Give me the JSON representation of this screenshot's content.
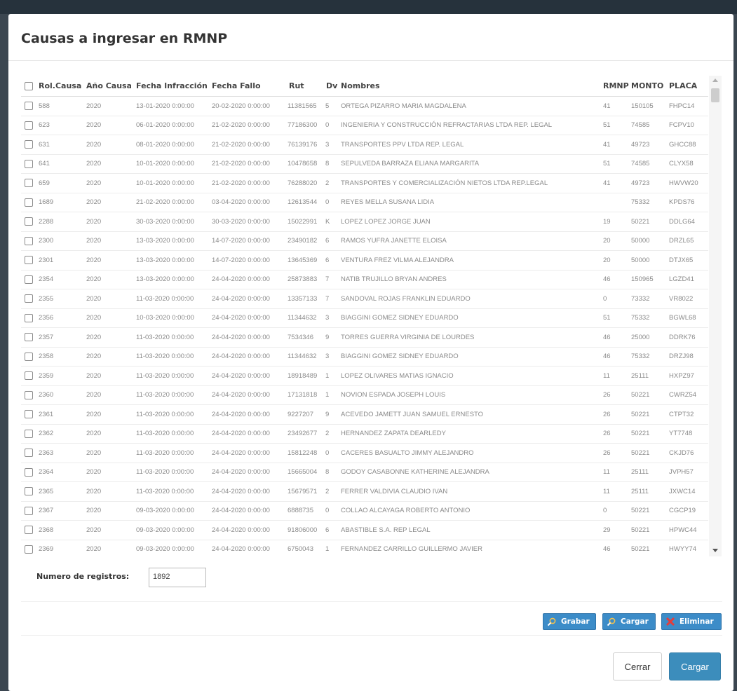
{
  "modal": {
    "title": "Causas a ingresar en RMNP"
  },
  "table": {
    "columns": [
      "Rol.Causa",
      "Año Causa",
      "Fecha Infracción",
      "Fecha Fallo",
      "Rut",
      "Dv",
      "Nombres",
      "RMNP",
      "MONTO",
      "PLACA"
    ],
    "rows": [
      [
        "588",
        "2020",
        "13-01-2020 0:00:00",
        "20-02-2020 0:00:00",
        "11381565",
        "5",
        "ORTEGA PIZARRO MARIA MAGDALENA",
        "41",
        "150105",
        "FHPC14"
      ],
      [
        "623",
        "2020",
        "06-01-2020 0:00:00",
        "21-02-2020 0:00:00",
        "77186300",
        "0",
        "INGENIERIA Y CONSTRUCCIÓN REFRACTARIAS LTDA REP. LEGAL",
        "51",
        "74585",
        "FCPV10"
      ],
      [
        "631",
        "2020",
        "08-01-2020 0:00:00",
        "21-02-2020 0:00:00",
        "76139176",
        "3",
        "TRANSPORTES PPV LTDA REP. LEGAL",
        "41",
        "49723",
        "GHCC88"
      ],
      [
        "641",
        "2020",
        "10-01-2020 0:00:00",
        "21-02-2020 0:00:00",
        "10478658",
        "8",
        "SEPULVEDA BARRAZA ELIANA MARGARITA",
        "51",
        "74585",
        "CLYX58"
      ],
      [
        "659",
        "2020",
        "10-01-2020 0:00:00",
        "21-02-2020 0:00:00",
        "76288020",
        "2",
        "TRANSPORTES Y COMERCIALIZACIÓN NIETOS LTDA REP.LEGAL",
        "41",
        "49723",
        "HWVW20"
      ],
      [
        "1689",
        "2020",
        "21-02-2020 0:00:00",
        "03-04-2020 0:00:00",
        "12613544",
        "0",
        "REYES MELLA SUSANA LIDIA",
        "",
        "75332",
        "KPDS76"
      ],
      [
        "2288",
        "2020",
        "30-03-2020 0:00:00",
        "30-03-2020 0:00:00",
        "15022991",
        "K",
        "LOPEZ LOPEZ JORGE JUAN",
        "19",
        "50221",
        "DDLG64"
      ],
      [
        "2300",
        "2020",
        "13-03-2020 0:00:00",
        "14-07-2020 0:00:00",
        "23490182",
        "6",
        "RAMOS YUFRA JANETTE ELOISA",
        "20",
        "50000",
        "DRZL65"
      ],
      [
        "2301",
        "2020",
        "13-03-2020 0:00:00",
        "14-07-2020 0:00:00",
        "13645369",
        "6",
        "VENTURA FREZ VILMA ALEJANDRA",
        "20",
        "50000",
        "DTJX65"
      ],
      [
        "2354",
        "2020",
        "13-03-2020 0:00:00",
        "24-04-2020 0:00:00",
        "25873883",
        "7",
        "NATIB TRUJILLO BRYAN ANDRES",
        "46",
        "150965",
        "LGZD41"
      ],
      [
        "2355",
        "2020",
        "11-03-2020 0:00:00",
        "24-04-2020 0:00:00",
        "13357133",
        "7",
        "SANDOVAL ROJAS FRANKLIN EDUARDO",
        "0",
        "73332",
        "VR8022"
      ],
      [
        "2356",
        "2020",
        "10-03-2020 0:00:00",
        "24-04-2020 0:00:00",
        "11344632",
        "3",
        "BIAGGINI GOMEZ SIDNEY EDUARDO",
        "51",
        "75332",
        "BGWL68"
      ],
      [
        "2357",
        "2020",
        "11-03-2020 0:00:00",
        "24-04-2020 0:00:00",
        "7534346",
        "9",
        "TORRES GUERRA VIRGINIA DE LOURDES",
        "46",
        "25000",
        "DDRK76"
      ],
      [
        "2358",
        "2020",
        "11-03-2020 0:00:00",
        "24-04-2020 0:00:00",
        "11344632",
        "3",
        "BIAGGINI GOMEZ SIDNEY EDUARDO",
        "46",
        "75332",
        "DRZJ98"
      ],
      [
        "2359",
        "2020",
        "11-03-2020 0:00:00",
        "24-04-2020 0:00:00",
        "18918489",
        "1",
        "LOPEZ OLIVARES MATIAS IGNACIO",
        "11",
        "25111",
        "HXPZ97"
      ],
      [
        "2360",
        "2020",
        "11-03-2020 0:00:00",
        "24-04-2020 0:00:00",
        "17131818",
        "1",
        "NOVION ESPADA JOSEPH LOUIS",
        "26",
        "50221",
        "CWRZ54"
      ],
      [
        "2361",
        "2020",
        "11-03-2020 0:00:00",
        "24-04-2020 0:00:00",
        "9227207",
        "9",
        "ACEVEDO JAMETT JUAN SAMUEL ERNESTO",
        "26",
        "50221",
        "CTPT32"
      ],
      [
        "2362",
        "2020",
        "11-03-2020 0:00:00",
        "24-04-2020 0:00:00",
        "23492677",
        "2",
        "HERNANDEZ ZAPATA DEARLEDY",
        "26",
        "50221",
        "YT7748"
      ],
      [
        "2363",
        "2020",
        "11-03-2020 0:00:00",
        "24-04-2020 0:00:00",
        "15812248",
        "0",
        "CACERES BASUALTO JIMMY ALEJANDRO",
        "26",
        "50221",
        "CKJD76"
      ],
      [
        "2364",
        "2020",
        "11-03-2020 0:00:00",
        "24-04-2020 0:00:00",
        "15665004",
        "8",
        "GODOY CASABONNE KATHERINE ALEJANDRA",
        "11",
        "25111",
        "JVPH57"
      ],
      [
        "2365",
        "2020",
        "11-03-2020 0:00:00",
        "24-04-2020 0:00:00",
        "15679571",
        "2",
        "FERRER VALDIVIA CLAUDIO IVAN",
        "11",
        "25111",
        "JXWC14"
      ],
      [
        "2367",
        "2020",
        "09-03-2020 0:00:00",
        "24-04-2020 0:00:00",
        "6888735",
        "0",
        "COLLAO ALCAYAGA ROBERTO ANTONIO",
        "0",
        "50221",
        "CGCP19"
      ],
      [
        "2368",
        "2020",
        "09-03-2020 0:00:00",
        "24-04-2020 0:00:00",
        "91806000",
        "6",
        "ABASTIBLE S.A. REP LEGAL",
        "29",
        "50221",
        "HPWC44"
      ],
      [
        "2369",
        "2020",
        "09-03-2020 0:00:00",
        "24-04-2020 0:00:00",
        "6750043",
        "1",
        "FERNANDEZ CARRILLO GUILLERMO JAVIER",
        "46",
        "50221",
        "HWYY74"
      ]
    ]
  },
  "records": {
    "label": "Numero de registros:",
    "value": "1892"
  },
  "toolbar": {
    "grabar": "Grabar",
    "cargar": "Cargar",
    "eliminar": "Eliminar"
  },
  "footer": {
    "cerrar": "Cerrar",
    "cargar": "Cargar"
  },
  "icons": {
    "grabar": "magnifier-icon",
    "cargar": "magnifier-icon",
    "eliminar": "delete-x-icon"
  },
  "colors": {
    "primary": "#3c8dbc",
    "toolbar_button": "#3c8cc8",
    "delete_icon": "#e23d3d"
  }
}
